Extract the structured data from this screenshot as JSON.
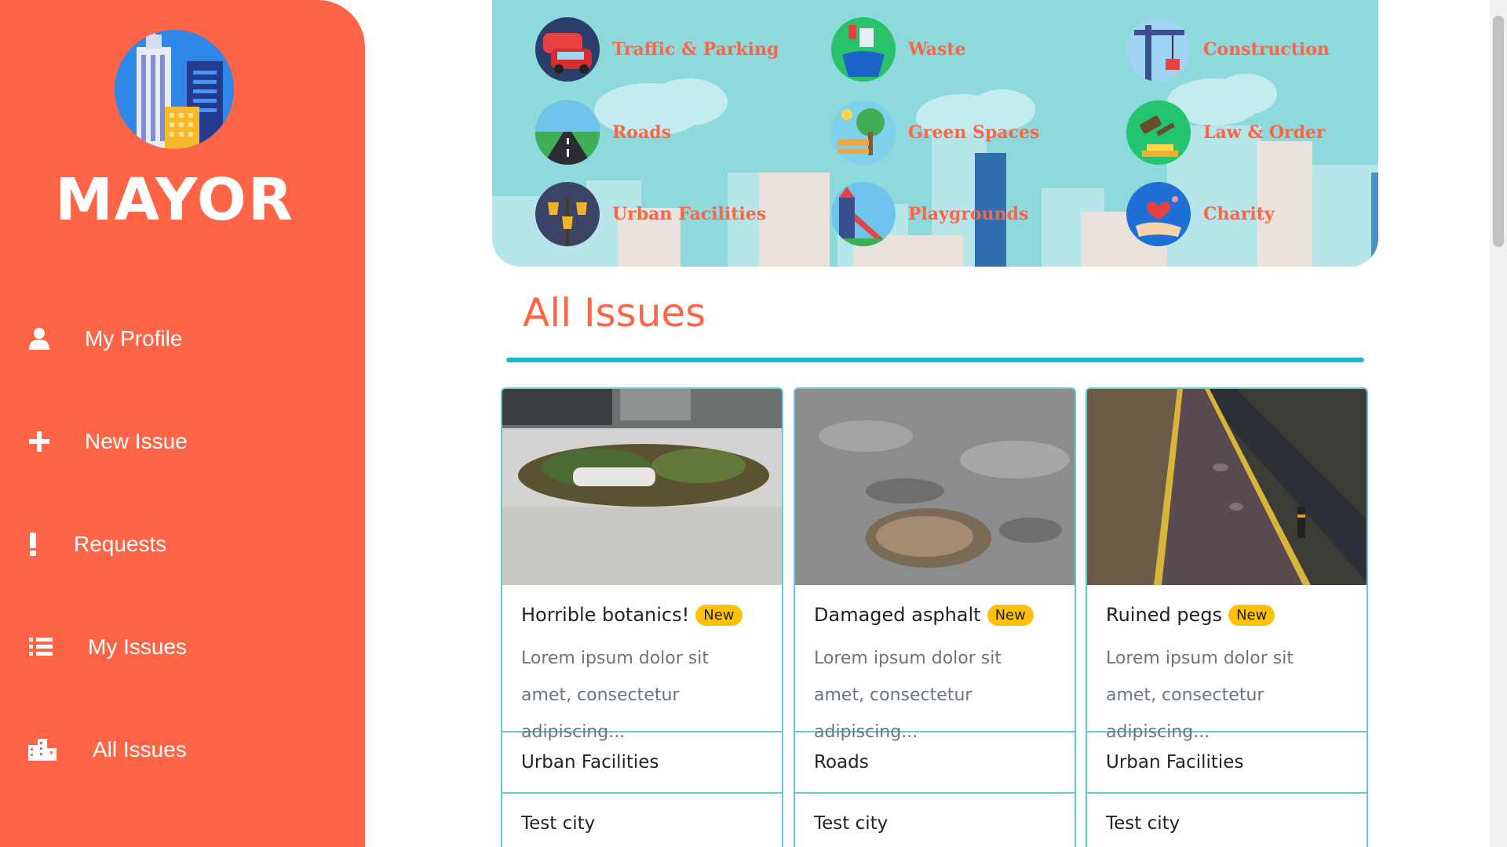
{
  "brand": {
    "name": "MAYOR",
    "logo_icon": "city-buildings-icon"
  },
  "sidebar": {
    "items": [
      {
        "label": "My Profile",
        "icon": "user-icon"
      },
      {
        "label": "New Issue",
        "icon": "plus-icon"
      },
      {
        "label": "Requests",
        "icon": "exclamation-icon"
      },
      {
        "label": "My Issues",
        "icon": "list-icon"
      },
      {
        "label": "All Issues",
        "icon": "city-icon"
      }
    ]
  },
  "categories": [
    {
      "label": "Traffic & Parking",
      "icon": "cars-icon"
    },
    {
      "label": "Waste",
      "icon": "trash-bin-icon"
    },
    {
      "label": "Construction",
      "icon": "crane-icon"
    },
    {
      "label": "Roads",
      "icon": "road-icon"
    },
    {
      "label": "Green Spaces",
      "icon": "tree-bench-icon"
    },
    {
      "label": "Law & Order",
      "icon": "gavel-icon"
    },
    {
      "label": "Urban Facilities",
      "icon": "street-lamp-icon"
    },
    {
      "label": "Playgrounds",
      "icon": "slide-icon"
    },
    {
      "label": "Charity",
      "icon": "heart-hands-icon"
    }
  ],
  "main": {
    "title": "All Issues"
  },
  "issues": [
    {
      "title": "Horrible botanics!",
      "badge": "New",
      "description": "Lorem ipsum dolor sit amet, consectetur adipiscing...",
      "category": "Urban Facilities",
      "city": "Test city"
    },
    {
      "title": "Damaged asphalt",
      "badge": "New",
      "description": "Lorem ipsum dolor sit amet, consectetur adipiscing...",
      "category": "Roads",
      "city": "Test city"
    },
    {
      "title": "Ruined pegs",
      "badge": "New",
      "description": "Lorem ipsum dolor sit amet, consectetur adipiscing...",
      "category": "Urban Facilities",
      "city": "Test city"
    }
  ],
  "colors": {
    "accent": "#fe6446",
    "banner": "#8dd9dc",
    "teal": "#18bcc6",
    "badge": "#ffc107"
  }
}
